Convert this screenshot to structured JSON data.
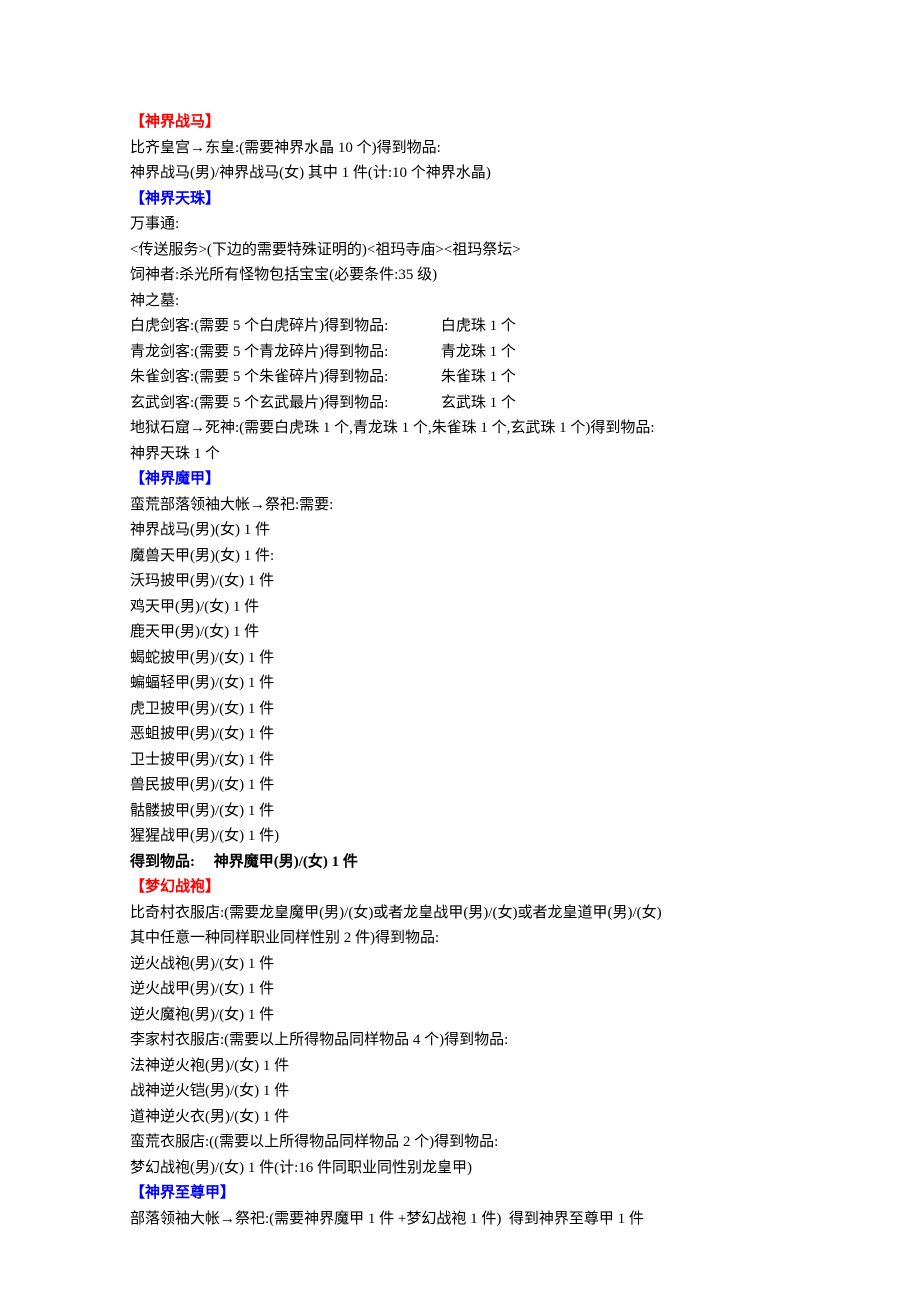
{
  "lines": [
    {
      "class": "bold red",
      "text": "【神界战马】"
    },
    {
      "class": "",
      "text": "比齐皇宫→东皇:(需要神界水晶 10 个)得到物品:"
    },
    {
      "class": "",
      "text": "神界战马(男)/神界战马(女) 其中 1 件(计:10 个神界水晶)"
    },
    {
      "class": "bold blue",
      "text": "【神界天珠】"
    },
    {
      "class": "",
      "text": "万事通:"
    },
    {
      "class": "",
      "text": "<传送服务>(下边的需要特殊证明的)<祖玛寺庙><祖玛祭坛>"
    },
    {
      "class": "",
      "text": "饲神者:杀光所有怪物包括宝宝(必要条件:35 级)"
    },
    {
      "class": "",
      "text": "神之墓:"
    },
    {
      "class": "",
      "text": "白虎剑客:(需要 5 个白虎碎片)得到物品:              白虎珠 1 个"
    },
    {
      "class": "",
      "text": "青龙剑客:(需要 5 个青龙碎片)得到物品:              青龙珠 1 个"
    },
    {
      "class": "",
      "text": "朱雀剑客:(需要 5 个朱雀碎片)得到物品:              朱雀珠 1 个"
    },
    {
      "class": "",
      "text": "玄武剑客:(需要 5 个玄武最片)得到物品:              玄武珠 1 个"
    },
    {
      "class": "",
      "text": "地狱石窟→死神:(需要白虎珠 1 个,青龙珠 1 个,朱雀珠 1 个,玄武珠 1 个)得到物品:"
    },
    {
      "class": "",
      "text": "神界天珠 1 个"
    },
    {
      "class": "bold blue",
      "text": "【神界魔甲】"
    },
    {
      "class": "",
      "text": "蛮荒部落领袖大帐→祭祀:需要:"
    },
    {
      "class": "",
      "text": "神界战马(男)(女) 1 件"
    },
    {
      "class": "",
      "text": "魔兽天甲(男)(女) 1 件:"
    },
    {
      "class": "",
      "text": "沃玛披甲(男)/(女) 1 件"
    },
    {
      "class": "",
      "text": "鸡天甲(男)/(女) 1 件"
    },
    {
      "class": "",
      "text": "鹿天甲(男)/(女) 1 件"
    },
    {
      "class": "",
      "text": "蝎蛇披甲(男)/(女) 1 件"
    },
    {
      "class": "",
      "text": "蝙蝠轻甲(男)/(女) 1 件"
    },
    {
      "class": "",
      "text": "虎卫披甲(男)/(女) 1 件"
    },
    {
      "class": "",
      "text": "恶蛆披甲(男)/(女) 1 件"
    },
    {
      "class": "",
      "text": "卫士披甲(男)/(女) 1 件"
    },
    {
      "class": "",
      "text": "兽民披甲(男)/(女) 1 件"
    },
    {
      "class": "",
      "text": "骷髅披甲(男)/(女) 1 件"
    },
    {
      "class": "",
      "text": "猩猩战甲(男)/(女) 1 件)"
    },
    {
      "class": "bold",
      "text": "得到物品:     神界魔甲(男)/(女) 1 件"
    },
    {
      "class": "bold red",
      "text": "【梦幻战袍】"
    },
    {
      "class": "",
      "text": "比奇村衣服店:(需要龙皇魔甲(男)/(女)或者龙皇战甲(男)/(女)或者龙皇道甲(男)/(女)"
    },
    {
      "class": "",
      "text": "其中任意一种同样职业同样性别 2 件)得到物品:"
    },
    {
      "class": "",
      "text": "逆火战袍(男)/(女) 1 件"
    },
    {
      "class": "",
      "text": "逆火战甲(男)/(女) 1 件"
    },
    {
      "class": "",
      "text": "逆火魔袍(男)/(女) 1 件"
    },
    {
      "class": "",
      "text": "李家村衣服店:(需要以上所得物品同样物品 4 个)得到物品:"
    },
    {
      "class": "",
      "text": "法神逆火袍(男)/(女) 1 件"
    },
    {
      "class": "",
      "text": "战神逆火铠(男)/(女) 1 件"
    },
    {
      "class": "",
      "text": "道神逆火衣(男)/(女) 1 件"
    },
    {
      "class": "",
      "text": "蛮荒衣服店:((需要以上所得物品同样物品 2 个)得到物品:"
    },
    {
      "class": "",
      "text": "梦幻战袍(男)/(女) 1 件(计:16 件同职业同性别龙皇甲)"
    },
    {
      "class": "bold blue",
      "text": "【神界至尊甲】"
    },
    {
      "class": "",
      "text": "部落领袖大帐→祭祀:(需要神界魔甲 1 件 +梦幻战袍 1 件)  得到神界至尊甲 1 件"
    }
  ]
}
